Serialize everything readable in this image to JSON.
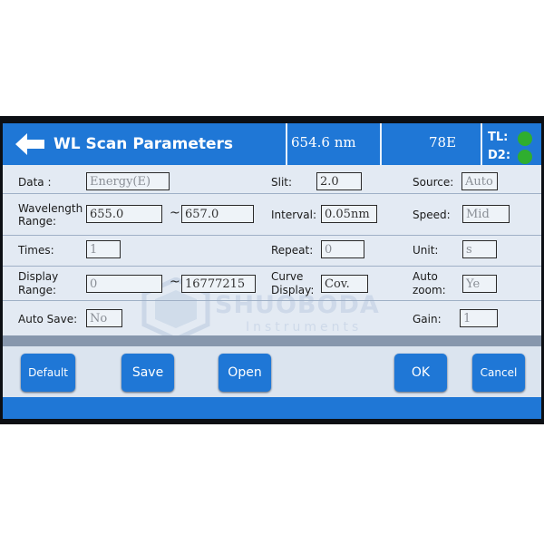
{
  "header": {
    "title": "WL Scan Parameters",
    "wavelength_readout": "654.6 nm",
    "energy_readout": "78E",
    "lamp_tl_label": "TL:",
    "lamp_d2_label": "D2:"
  },
  "form": {
    "data": {
      "label": "Data :",
      "value": "Energy(E)"
    },
    "slit": {
      "label": "Slit:",
      "value": "2.0"
    },
    "source": {
      "label": "Source:",
      "value": "Auto"
    },
    "wavelength_range": {
      "label_line1": "Wavelength",
      "label_line2": "Range:",
      "from": "655.0",
      "to": "657.0"
    },
    "interval": {
      "label": "Interval:",
      "value": "0.05nm"
    },
    "speed": {
      "label": "Speed:",
      "value": "Mid"
    },
    "times": {
      "label": "Times:",
      "value": "1"
    },
    "repeat": {
      "label": "Repeat:",
      "value": "0"
    },
    "unit": {
      "label": "Unit:",
      "value": "s"
    },
    "display_range": {
      "label_line1": "Display",
      "label_line2": "Range:",
      "from": "0",
      "to": "16777215"
    },
    "curve_display": {
      "label_line1": "Curve",
      "label_line2": "Display:",
      "value": "Cov."
    },
    "auto_zoom": {
      "label_line1": "Auto",
      "label_line2": "zoom:",
      "value": "Ye"
    },
    "auto_save": {
      "label": "Auto Save:",
      "value": "No"
    },
    "gain": {
      "label": "Gain:",
      "value": "1"
    },
    "tilde": "~"
  },
  "watermark": {
    "brand": "SHUOBODA",
    "sub": "Instruments"
  },
  "buttons": {
    "default": "Default",
    "save": "Save",
    "open": "Open",
    "ok": "OK",
    "cancel": "Cancel"
  },
  "colors": {
    "accent": "#1f77d6",
    "lamp_on": "#2fae2f",
    "form_bg": "#e3eaf3",
    "separator": "#8797ad"
  }
}
